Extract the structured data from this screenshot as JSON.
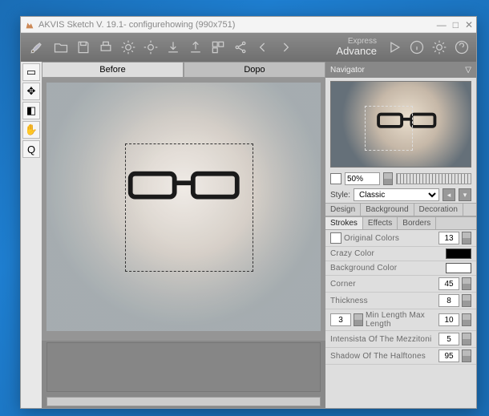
{
  "window": {
    "title": "AKVIS Sketch V. 19.1- configurehowing (990x751)"
  },
  "mode": {
    "line1": "Express",
    "line2": "Advance"
  },
  "tabs": {
    "before": "Before",
    "after": "Dopo"
  },
  "navigator": {
    "title": "Navigator"
  },
  "zoom": {
    "value": "50%"
  },
  "style": {
    "label": "Style:",
    "value": "Classic"
  },
  "sections": {
    "design": "Design",
    "background": "Background",
    "decoration": "Decoration",
    "strokes": "Strokes",
    "effects": "Effects",
    "borders": "Borders"
  },
  "params": {
    "original_colors": {
      "label": "Original Colors",
      "value": "13"
    },
    "crazy_color": {
      "label": "Crazy Color",
      "swatch": "#000000"
    },
    "background_color": {
      "label": "Background Color",
      "swatch": "#ffffff"
    },
    "corner": {
      "label": "Corner",
      "value": "45"
    },
    "thickness": {
      "label": "Thickness",
      "value": "8"
    },
    "min_max": {
      "min": "3",
      "label": "Min Length Max Length",
      "max": "10"
    },
    "mezzitoni": {
      "label": "Intensista Of The Mezzitoni",
      "value": "5"
    },
    "shadow": {
      "label": "Shadow Of The Halftones",
      "value": "95"
    }
  }
}
